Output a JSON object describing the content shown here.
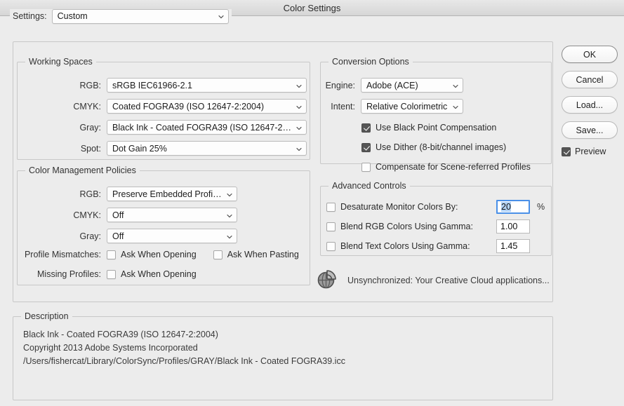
{
  "window": {
    "title": "Color Settings"
  },
  "settings": {
    "label": "Settings:",
    "value": "Custom"
  },
  "working_spaces": {
    "legend": "Working Spaces",
    "rows": [
      {
        "label": "RGB:",
        "value": "sRGB IEC61966-2.1"
      },
      {
        "label": "CMYK:",
        "value": "Coated FOGRA39 (ISO 12647-2:2004)"
      },
      {
        "label": "Gray:",
        "value": "Black Ink - Coated FOGRA39 (ISO 12647-2:20..."
      },
      {
        "label": "Spot:",
        "value": "Dot Gain 25%"
      }
    ]
  },
  "policies": {
    "legend": "Color Management Policies",
    "rows": [
      {
        "label": "RGB:",
        "value": "Preserve Embedded Profiles"
      },
      {
        "label": "CMYK:",
        "value": "Off"
      },
      {
        "label": "Gray:",
        "value": "Off"
      }
    ],
    "profile_mismatches": {
      "label": "Profile Mismatches:",
      "ask_when_opening": {
        "label": "Ask When Opening",
        "checked": false
      },
      "ask_when_pasting": {
        "label": "Ask When Pasting",
        "checked": false
      }
    },
    "missing_profiles": {
      "label": "Missing Profiles:",
      "ask_when_opening": {
        "label": "Ask When Opening",
        "checked": false
      }
    }
  },
  "conversion": {
    "legend": "Conversion Options",
    "engine": {
      "label": "Engine:",
      "value": "Adobe (ACE)"
    },
    "intent": {
      "label": "Intent:",
      "value": "Relative Colorimetric"
    },
    "checks": [
      {
        "label": "Use Black Point Compensation",
        "checked": true
      },
      {
        "label": "Use Dither (8-bit/channel images)",
        "checked": true
      },
      {
        "label": "Compensate for Scene-referred Profiles",
        "checked": false
      }
    ]
  },
  "advanced": {
    "legend": "Advanced Controls",
    "rows": [
      {
        "label": "Desaturate Monitor Colors By:",
        "checked": false,
        "value": "20",
        "suffix": "%",
        "focused": true
      },
      {
        "label": "Blend RGB Colors Using Gamma:",
        "checked": false,
        "value": "1.00",
        "suffix": "",
        "focused": false
      },
      {
        "label": "Blend Text Colors Using Gamma:",
        "checked": false,
        "value": "1.45",
        "suffix": "",
        "focused": false
      }
    ]
  },
  "sync": {
    "icon": "cloud-sync-globe-icon",
    "text": "Unsynchronized: Your Creative Cloud applications..."
  },
  "description": {
    "legend": "Description",
    "lines": [
      "Black Ink - Coated FOGRA39 (ISO 12647-2:2004)",
      "Copyright 2013 Adobe Systems Incorporated",
      "/Users/fishercat/Library/ColorSync/Profiles/GRAY/Black Ink - Coated FOGRA39.icc"
    ]
  },
  "buttons": {
    "ok": "OK",
    "cancel": "Cancel",
    "load": "Load...",
    "save": "Save...",
    "preview": {
      "label": "Preview",
      "checked": true
    }
  },
  "colors": {
    "window_bg": "#ececec",
    "accent_focus": "#4a90e8",
    "selection": "#b4d3f5",
    "checkbox_checked": "#555555"
  }
}
